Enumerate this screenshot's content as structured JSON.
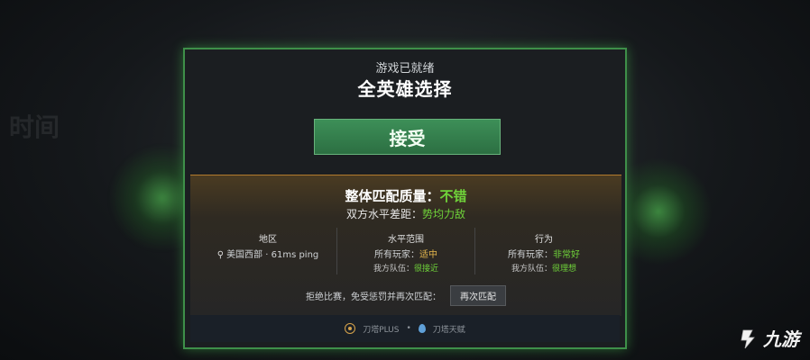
{
  "background": {
    "faded_text": "时间"
  },
  "dialog": {
    "ready_title": "游戏已就绪",
    "mode_title": "全英雄选择",
    "accept_label": "接受",
    "quality": {
      "label": "整体匹配质量：",
      "value": "不错",
      "balance_label": "双方水平差距：",
      "balance_value": "势均力敌"
    },
    "columns": [
      {
        "head": "地区",
        "row1_text": "美国西部 · 61ms ping",
        "row2_text": ""
      },
      {
        "head": "水平范围",
        "row1_label": "所有玩家：",
        "row1_value": "适中",
        "row2_label": "我方队伍：",
        "row2_value": "很接近"
      },
      {
        "head": "行为",
        "row1_label": "所有玩家：",
        "row1_value": "非常好",
        "row2_label": "我方队伍：",
        "row2_value": "很理想"
      }
    ],
    "decline_text": "拒绝比赛，免受惩罚并再次匹配：",
    "requeue_label": "再次匹配",
    "footer": {
      "plus_label": "刀塔PLUS",
      "separator": "•",
      "second_label": "刀塔天赋"
    }
  },
  "watermark": {
    "logo_text": "九游"
  },
  "colors": {
    "accent_green": "#6fd23a",
    "accent_orange": "#e3b54c",
    "border_green": "#3e8f49",
    "panel_gold": "#b17b2c"
  },
  "icons": {
    "location": "location-pin-icon",
    "plus": "dota-plus-icon",
    "drop": "water-drop-icon"
  }
}
